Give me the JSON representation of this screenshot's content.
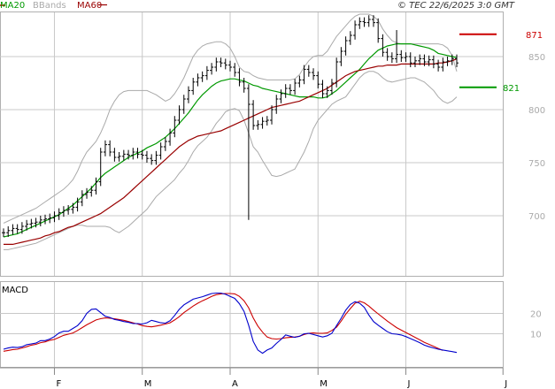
{
  "header": {
    "ma20_label": "MA20",
    "bbands_label": "BBands",
    "ma60_label": "MA60",
    "source": "© TEC 22/6/2025 3:0 GMT"
  },
  "macd_panel": {
    "title": "MACD"
  },
  "colors": {
    "ma20": "#009900",
    "ma60": "#990000",
    "bbands": "#aaaaaa",
    "price_bars": "#000000",
    "resistance": "#cc0000",
    "support": "#009900",
    "macd_line": "#0000cc",
    "signal_line": "#cc0000",
    "grid": "#c8c8c8"
  },
  "chart_data": [
    {
      "type": "ohlc",
      "title": "",
      "xlabel": "",
      "ylabel": "",
      "x_tick_labels": [
        "F",
        "M",
        "A",
        "M",
        "J",
        "J"
      ],
      "y_tick_labels": [
        "700",
        "750",
        "800",
        "850"
      ],
      "ylim": [
        660,
        890
      ],
      "grid": true,
      "levels": [
        {
          "label": "871",
          "value": 871,
          "color": "#cc0000"
        },
        {
          "label": "821",
          "value": 821,
          "color": "#009900"
        }
      ],
      "close": [
        684,
        686,
        688,
        687,
        690,
        692,
        693,
        694,
        696,
        697,
        698,
        700,
        703,
        705,
        706,
        708,
        713,
        720,
        722,
        724,
        732,
        760,
        767,
        760,
        755,
        756,
        758,
        757,
        760,
        758,
        757,
        754,
        752,
        757,
        765,
        770,
        778,
        790,
        800,
        810,
        818,
        826,
        830,
        832,
        837,
        840,
        845,
        844,
        842,
        840,
        835,
        826,
        820,
        805,
        785,
        786,
        789,
        790,
        800,
        810,
        815,
        820,
        818,
        825,
        828,
        838,
        835,
        832,
        824,
        815,
        818,
        825,
        845,
        855,
        865,
        870,
        880,
        883,
        882,
        885,
        882,
        867,
        854,
        850,
        848,
        852,
        849,
        850,
        844,
        846,
        848,
        845,
        847,
        843,
        840,
        845,
        846,
        848,
        844
      ],
      "series": [
        {
          "name": "MA20",
          "values": [
            680,
            681,
            682,
            683,
            685,
            687,
            689,
            691,
            693,
            695,
            697,
            699,
            701,
            704,
            707,
            710,
            714,
            718,
            722,
            726,
            731,
            736,
            740,
            743,
            746,
            749,
            752,
            755,
            757,
            759,
            761,
            764,
            766,
            768,
            771,
            774,
            778,
            782,
            787,
            792,
            797,
            803,
            809,
            814,
            818,
            822,
            825,
            827,
            828,
            829,
            829,
            828,
            827,
            825,
            823,
            822,
            820,
            819,
            818,
            817,
            816,
            815,
            814,
            813,
            812,
            812,
            812,
            812,
            811,
            811,
            812,
            815,
            818,
            822,
            826,
            830,
            834,
            838,
            843,
            848,
            852,
            856,
            858,
            860,
            861,
            862,
            862,
            862,
            862,
            861,
            860,
            859,
            858,
            856,
            853,
            852,
            851,
            850,
            849
          ]
        },
        {
          "name": "MA60",
          "values": [
            673,
            673,
            673,
            674,
            675,
            676,
            677,
            678,
            679,
            681,
            682,
            684,
            685,
            687,
            689,
            690,
            692,
            694,
            696,
            698,
            700,
            702,
            705,
            708,
            711,
            714,
            717,
            721,
            725,
            729,
            733,
            737,
            741,
            745,
            749,
            753,
            757,
            761,
            765,
            768,
            771,
            773,
            775,
            776,
            777,
            778,
            779,
            780,
            782,
            784,
            786,
            788,
            790,
            792,
            794,
            796,
            798,
            800,
            802,
            803,
            804,
            805,
            806,
            807,
            808,
            810,
            812,
            814,
            816,
            818,
            820,
            823,
            826,
            829,
            832,
            834,
            836,
            837,
            838,
            839,
            840,
            841,
            841,
            842,
            842,
            842,
            843,
            843,
            843,
            843,
            843,
            843,
            843,
            843,
            844,
            844,
            845,
            846,
            848
          ]
        },
        {
          "name": "BBands upper",
          "values": [
            693,
            695,
            697,
            699,
            701,
            703,
            705,
            707,
            710,
            713,
            716,
            719,
            722,
            725,
            729,
            734,
            742,
            752,
            760,
            765,
            770,
            778,
            788,
            800,
            808,
            814,
            817,
            818,
            818,
            818,
            818,
            818,
            816,
            814,
            811,
            808,
            810,
            815,
            822,
            830,
            840,
            850,
            856,
            860,
            862,
            863,
            864,
            864,
            862,
            858,
            850,
            840,
            836,
            835,
            832,
            830,
            829,
            828,
            828,
            828,
            828,
            828,
            828,
            829,
            833,
            840,
            846,
            850,
            851,
            851,
            855,
            862,
            869,
            874,
            879,
            884,
            888,
            890,
            890,
            890,
            888,
            884,
            876,
            870,
            865,
            863,
            862,
            862,
            862,
            862,
            862,
            862,
            862,
            862,
            862,
            861,
            858,
            851,
            836
          ]
        },
        {
          "name": "BBands lower",
          "values": [
            668,
            668,
            669,
            670,
            671,
            672,
            673,
            674,
            676,
            678,
            680,
            682,
            684,
            686,
            688,
            690,
            691,
            691,
            690,
            690,
            690,
            690,
            690,
            689,
            686,
            684,
            687,
            690,
            694,
            698,
            702,
            706,
            712,
            718,
            722,
            726,
            730,
            734,
            740,
            745,
            752,
            760,
            766,
            770,
            774,
            780,
            787,
            792,
            798,
            800,
            801,
            799,
            790,
            778,
            765,
            760,
            752,
            745,
            738,
            737,
            738,
            740,
            742,
            744,
            752,
            760,
            770,
            782,
            790,
            795,
            800,
            805,
            808,
            810,
            812,
            818,
            824,
            830,
            834,
            836,
            836,
            834,
            830,
            827,
            826,
            827,
            828,
            829,
            830,
            830,
            828,
            826,
            822,
            818,
            812,
            808,
            806,
            808,
            812
          ]
        },
        {
          "name": "MACD",
          "values": [
            2.4,
            3,
            3.4,
            3.2,
            3.6,
            4.6,
            5,
            5.4,
            6.6,
            6.6,
            7.4,
            8.6,
            10.4,
            11.2,
            11.2,
            12.6,
            14,
            16.4,
            20,
            22,
            22.2,
            20.4,
            18.6,
            18,
            17,
            16.6,
            16,
            15.6,
            15,
            15,
            14.8,
            15.4,
            16.6,
            16,
            15.4,
            15.2,
            16.4,
            19,
            22,
            24.2,
            25.6,
            27,
            27.6,
            28.2,
            29,
            29.8,
            30,
            30,
            29.4,
            28.4,
            27.4,
            24.8,
            21,
            14.2,
            6.2,
            2,
            0.4,
            2,
            3,
            5.2,
            7.2,
            9.4,
            8.8,
            8.2,
            8.8,
            10,
            10.2,
            9.6,
            9,
            8.4,
            9,
            10.2,
            14,
            17.6,
            21.6,
            24.4,
            25.8,
            25,
            23,
            19.2,
            16,
            14.2,
            12.6,
            11,
            10,
            9.8,
            9.4,
            8.6,
            7.6,
            6.6,
            5.6,
            4.4,
            3.6,
            3,
            2.4,
            2,
            1.6,
            1.2,
            0.8
          ]
        },
        {
          "name": "Signal",
          "values": [
            1.4,
            1.8,
            2.2,
            2.4,
            3,
            3.6,
            4.4,
            4.8,
            5.6,
            6,
            6.8,
            7.2,
            8.2,
            9.2,
            9.8,
            10.4,
            11.6,
            13,
            14.4,
            15.6,
            16.8,
            17.4,
            17.8,
            17.6,
            17.4,
            17,
            16.6,
            16,
            15.4,
            14.8,
            14,
            13.6,
            13.4,
            13.8,
            14.2,
            14.8,
            15.4,
            16.8,
            18.4,
            20.4,
            22,
            23.6,
            25,
            26.2,
            27.2,
            28.4,
            29.2,
            29.6,
            29.8,
            29.8,
            29.6,
            28.4,
            26.2,
            22.8,
            17.8,
            13.8,
            10.8,
            8.4,
            7.6,
            7.4,
            7.6,
            8,
            8.2,
            8.4,
            8.8,
            9.6,
            10.2,
            10.4,
            10.2,
            10.2,
            10.4,
            11.6,
            13.2,
            16.2,
            19.6,
            22.4,
            25,
            26,
            25.2,
            23.6,
            21.6,
            19.8,
            18,
            16.2,
            14.6,
            13,
            11.8,
            10.6,
            9.4,
            8.2,
            7,
            5.8,
            4.8,
            3.8,
            2.8,
            1.8
          ]
        }
      ]
    },
    {
      "type": "line",
      "title": "MACD",
      "y_tick_labels": [
        "10",
        "20"
      ],
      "ylim": [
        -5,
        35
      ],
      "grid": true
    }
  ]
}
